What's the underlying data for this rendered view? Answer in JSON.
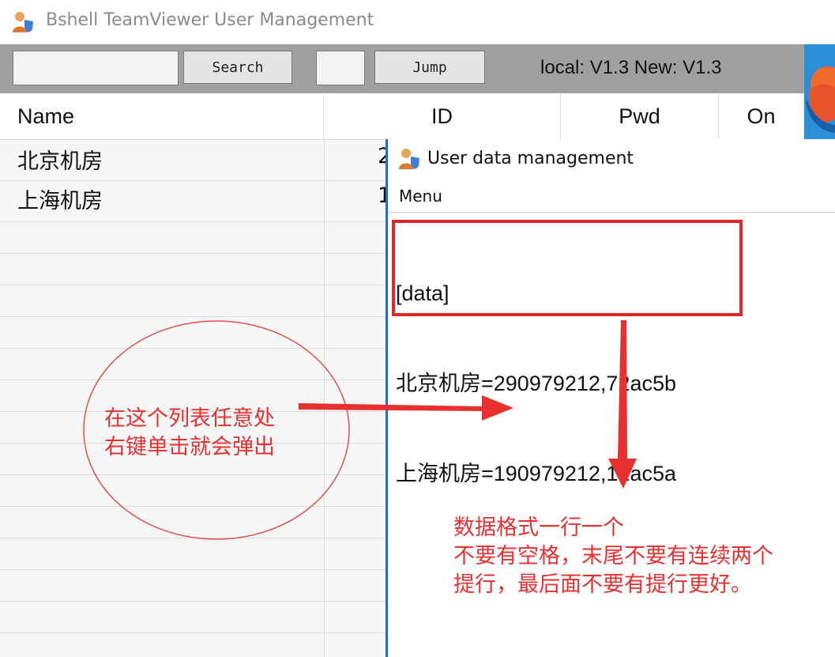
{
  "window": {
    "title": "Bshell TeamViewer User Management"
  },
  "toolbar": {
    "search_value": "",
    "search_label": "Search",
    "jump_value": "",
    "jump_label": "Jump",
    "version_text": "local: V1.3  New: V1.3"
  },
  "list": {
    "columns": [
      "Name",
      "ID",
      "Pwd",
      "On"
    ],
    "rows": [
      {
        "name": "北京机房",
        "id_partial": "2"
      },
      {
        "name": "上海机房",
        "id_partial": "1"
      }
    ]
  },
  "dialog": {
    "title": "User data management",
    "menu": [
      "Menu"
    ],
    "content_lines": [
      "[data]",
      "北京机房=290979212,72ac5b",
      "上海机房=190979212,12ac5a"
    ]
  },
  "annotations": {
    "circle_text": [
      "在这个列表任意处",
      "右键单击就会弹出"
    ],
    "format_note": [
      "数据格式一行一个",
      "不要有空格，末尾不要有连续两个",
      "提行，最后面不要有提行更好。"
    ],
    "color": "#e83030"
  },
  "icons": {
    "app": "user-shield-icon",
    "side": "teamviewer-logo-icon"
  }
}
